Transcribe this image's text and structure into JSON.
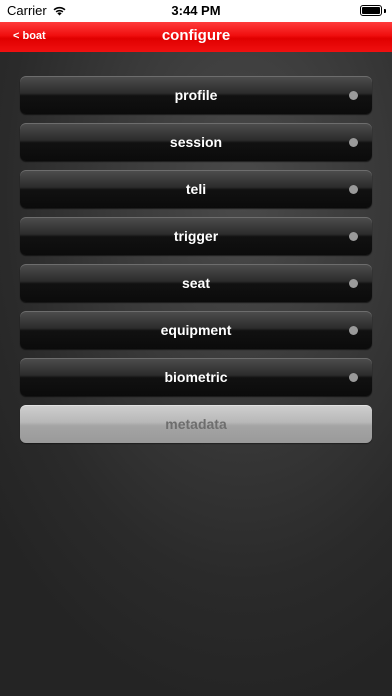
{
  "status_bar": {
    "carrier": "Carrier",
    "time": "3:44 PM"
  },
  "nav": {
    "back_label": "< boat",
    "title": "configure"
  },
  "menu": {
    "items": [
      {
        "label": "profile"
      },
      {
        "label": "session"
      },
      {
        "label": "teli"
      },
      {
        "label": "trigger"
      },
      {
        "label": "seat"
      },
      {
        "label": "equipment"
      },
      {
        "label": "biometric"
      },
      {
        "label": "metadata",
        "disabled": true
      }
    ]
  },
  "colors": {
    "nav_accent": "#f01010",
    "background_dark": "#2a2a2a",
    "indicator_dot": "#9a9a9a"
  },
  "icons": [
    "wifi-icon",
    "battery-icon",
    "indicator-dot"
  ]
}
